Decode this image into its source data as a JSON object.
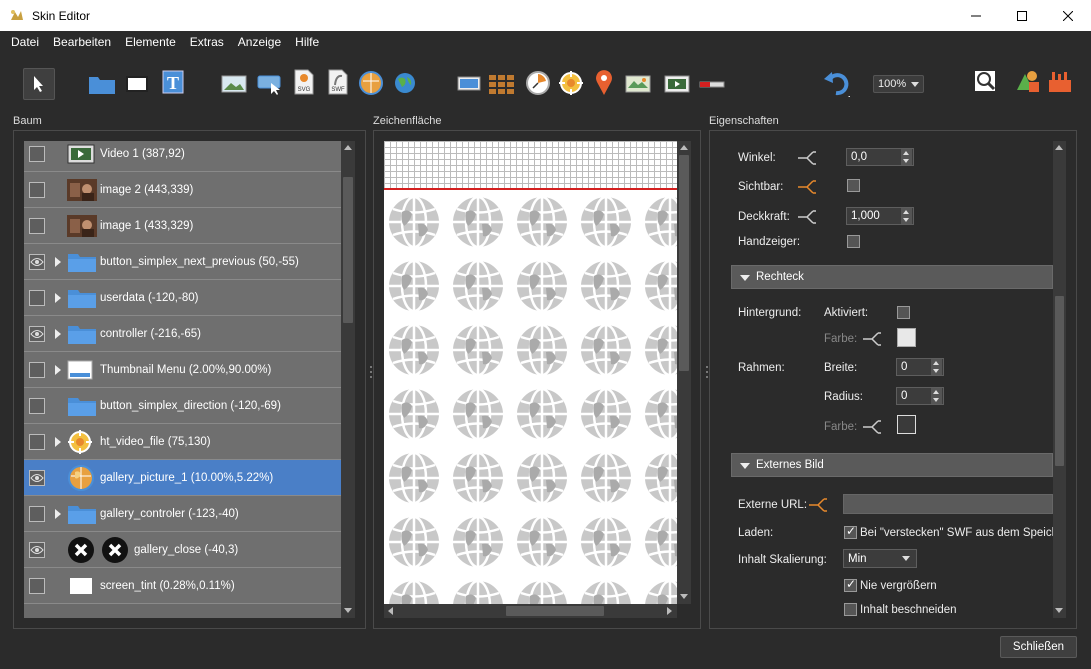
{
  "window": {
    "title": "Skin Editor"
  },
  "menu": [
    {
      "label": "Datei"
    },
    {
      "label": "Bearbeiten"
    },
    {
      "label": "Elemente"
    },
    {
      "label": "Extras"
    },
    {
      "label": "Anzeige"
    },
    {
      "label": "Hilfe"
    }
  ],
  "toolbar": {
    "zoom": "100%"
  },
  "panels": {
    "tree": "Baum",
    "canvas": "Zeichenfläche",
    "properties": "Eigenschaften"
  },
  "tree": {
    "rows": [
      {
        "label": "Video 1 (387,92)",
        "icon": "video-icon",
        "eye": false,
        "expand": false
      },
      {
        "label": "image 2 (443,339)",
        "icon": "image-thumbnail",
        "eye": false,
        "expand": false
      },
      {
        "label": "image 1 (433,329)",
        "icon": "image-thumbnail",
        "eye": false,
        "expand": false
      },
      {
        "label": "button_simplex_next_previous (50,-55)",
        "icon": "folder-icon",
        "eye": true,
        "expand": true
      },
      {
        "label": "userdata (-120,-80)",
        "icon": "folder-icon",
        "eye": false,
        "expand": true
      },
      {
        "label": "controller (-216,-65)",
        "icon": "folder-icon",
        "eye": true,
        "expand": true
      },
      {
        "label": "Thumbnail Menu (2.00%,90.00%)",
        "icon": "thumbnail-menu-icon",
        "eye": false,
        "expand": true
      },
      {
        "label": "button_simplex_direction (-120,-69)",
        "icon": "folder-icon",
        "eye": false,
        "expand": false
      },
      {
        "label": "ht_video_file (75,130)",
        "icon": "hotspot-icon",
        "eye": false,
        "expand": true
      },
      {
        "label": "gallery_picture_1 (10.00%,5.22%)",
        "icon": "globe-icon",
        "eye": true,
        "expand": false,
        "selected": true
      },
      {
        "label": "gallery_controler (-123,-40)",
        "icon": "folder-icon",
        "eye": false,
        "expand": true
      },
      {
        "label": "gallery_close (-40,3)",
        "icon": "close-buttons-icon",
        "eye": true,
        "expand": false
      },
      {
        "label": "screen_tint (0.28%,0.11%)",
        "icon": "rectangle-icon",
        "eye": false,
        "expand": false
      }
    ]
  },
  "properties": {
    "winkel": {
      "label": "Winkel:",
      "value": "0,0"
    },
    "sichtbar": {
      "label": "Sichtbar:"
    },
    "deckkraft": {
      "label": "Deckkraft:",
      "value": "1,000"
    },
    "handzeiger": {
      "label": "Handzeiger:"
    },
    "rechteck": {
      "title": "Rechteck",
      "hintergrund": "Hintergrund:",
      "aktiviert": "Aktiviert:",
      "farbe": "Farbe:",
      "rahmen": "Rahmen:",
      "breite": "Breite:",
      "breite_value": "0",
      "radius": "Radius:",
      "radius_value": "0"
    },
    "externes_bild": {
      "title": "Externes Bild",
      "url_label": "Externe URL:",
      "laden_label": "Laden:",
      "laden_option": "Bei \"verstecken\" SWF aus dem Speicher",
      "skalierung_label": "Inhalt Skalierung:",
      "skalierung_value": "Min",
      "nie_vergroessern": "Nie vergrößern",
      "inhalt_beschneiden": "Inhalt beschneiden"
    }
  },
  "footer": {
    "close": "Schließen"
  },
  "colors": {
    "selection": "#4a7fc7",
    "accent": "#e8892c",
    "folder": "#4a8fd8",
    "redline": "#d42020"
  }
}
